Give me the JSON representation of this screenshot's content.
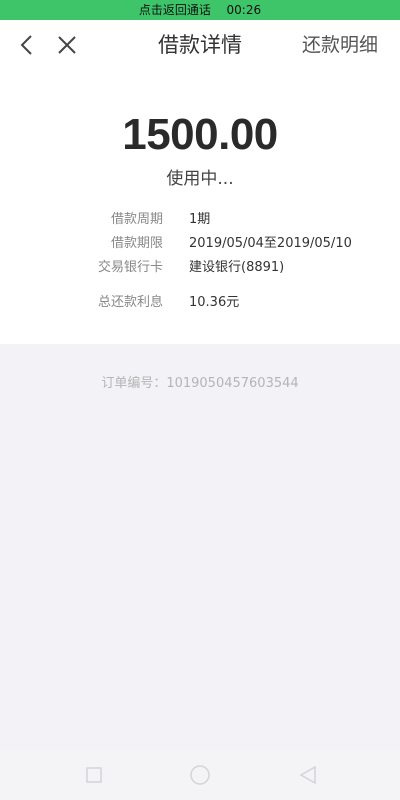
{
  "status_bar": {
    "call_text": "点击返回通话",
    "time": "00:26"
  },
  "nav": {
    "title": "借款详情",
    "action_label": "还款明细",
    "back_icon": "chevron-left-icon",
    "close_icon": "close-icon"
  },
  "loan": {
    "amount": "1500.00",
    "status": "使用中...",
    "details": [
      {
        "label": "借款周期",
        "value": "1期"
      },
      {
        "label": "借款期限",
        "value": "2019/05/04至2019/05/10"
      },
      {
        "label": "交易银行卡",
        "value": "建设银行(8891)"
      },
      {
        "label": "总还款利息",
        "value": "10.36元"
      }
    ]
  },
  "order": {
    "text": "订单编号：1019050457603544"
  },
  "system_nav": {
    "icons": [
      "square-icon",
      "circle-icon",
      "triangle-back-icon"
    ]
  },
  "colors": {
    "call_bar": "#3ec56a",
    "background": "#f2f2f7"
  }
}
